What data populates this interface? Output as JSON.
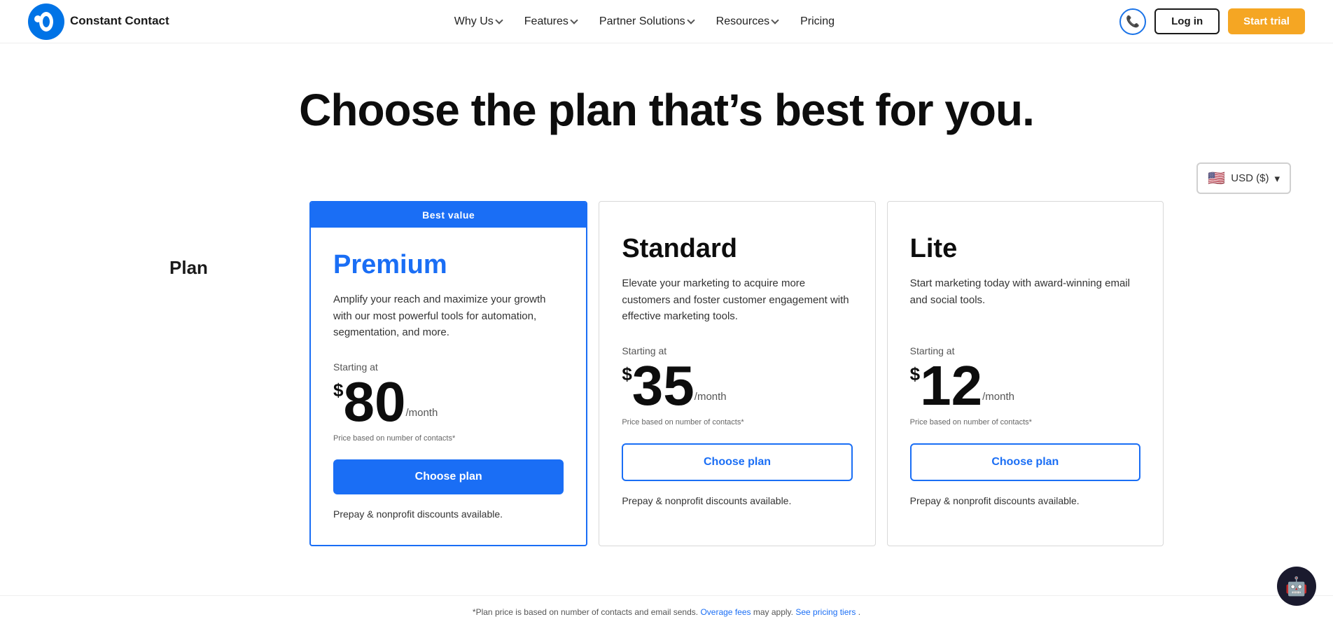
{
  "brand": {
    "name": "Constant Contact",
    "logo_alt": "Constant Contact logo"
  },
  "nav": {
    "links": [
      {
        "id": "why-us",
        "label": "Why Us",
        "has_dropdown": true
      },
      {
        "id": "features",
        "label": "Features",
        "has_dropdown": true
      },
      {
        "id": "partner-solutions",
        "label": "Partner Solutions",
        "has_dropdown": true
      },
      {
        "id": "resources",
        "label": "Resources",
        "has_dropdown": true
      },
      {
        "id": "pricing",
        "label": "Pricing",
        "has_dropdown": false
      }
    ],
    "login_label": "Log in",
    "trial_label": "Start trial",
    "phone_icon": "📞"
  },
  "hero": {
    "title": "Choose the plan that’s best for you."
  },
  "currency": {
    "label": "USD ($)",
    "flag": "🇺🇸",
    "chevron": "▾"
  },
  "plan_column_label": "Plan",
  "plans": [
    {
      "id": "premium",
      "name": "Premium",
      "is_best_value": true,
      "best_value_label": "Best value",
      "description": "Amplify your reach and maximize your growth with our most powerful tools for automation, segmentation, and more.",
      "starting_at": "Starting at",
      "price_dollar": "$",
      "price": "80",
      "price_period": "/month",
      "price_note": "Price based on number of contacts*",
      "cta_label": "Choose plan",
      "cta_style": "blue",
      "prepay_note": "Prepay & nonprofit discounts available."
    },
    {
      "id": "standard",
      "name": "Standard",
      "is_best_value": false,
      "description": "Elevate your marketing to acquire more customers and foster customer engagement with effective marketing tools.",
      "starting_at": "Starting at",
      "price_dollar": "$",
      "price": "35",
      "price_period": "/month",
      "price_note": "Price based on number of contacts*",
      "cta_label": "Choose plan",
      "cta_style": "outline",
      "prepay_note": "Prepay & nonprofit discounts available."
    },
    {
      "id": "lite",
      "name": "Lite",
      "is_best_value": false,
      "description": "Start marketing today with award-winning email and social tools.",
      "starting_at": "Starting at",
      "price_dollar": "$",
      "price": "12",
      "price_period": "/month",
      "price_note": "Price based on number of contacts*",
      "cta_label": "Choose plan",
      "cta_style": "outline",
      "prepay_note": "Prepay & nonprofit discounts available."
    }
  ],
  "footer_note": {
    "text_before": "*Plan price is based on number of contacts and email sends.",
    "link1_label": "Overage fees",
    "text_middle": " may apply.",
    "link2_label": "See pricing tiers",
    "text_after": "."
  }
}
